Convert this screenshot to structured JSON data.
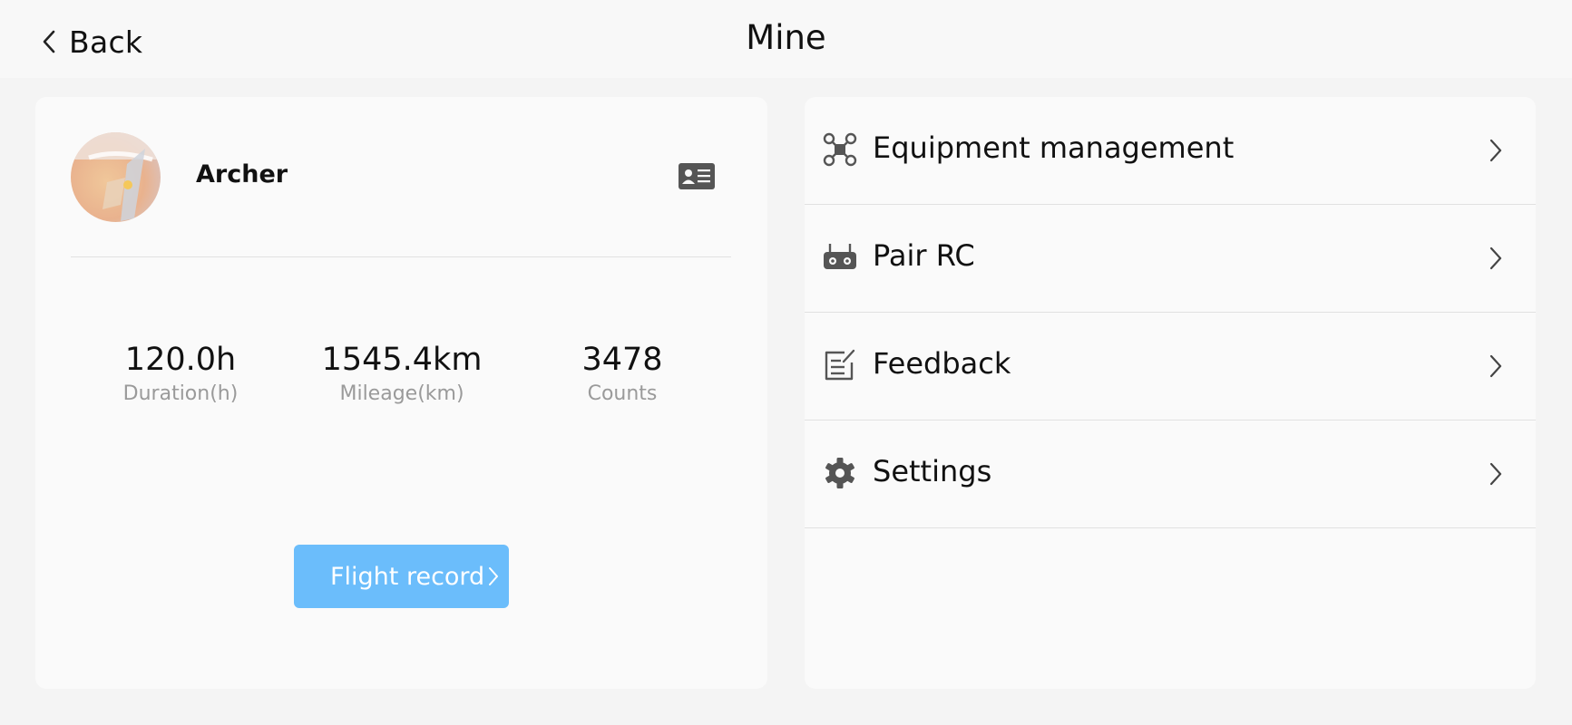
{
  "header": {
    "back_label": "Back",
    "title": "Mine"
  },
  "profile": {
    "username": "Archer",
    "stats": [
      {
        "value": "120.0h",
        "label": "Duration(h)"
      },
      {
        "value": "1545.4km",
        "label": "Mileage(km)"
      },
      {
        "value": "3478",
        "label": "Counts"
      }
    ],
    "flight_record_label": "Flight record"
  },
  "menu": [
    {
      "label": "Equipment management",
      "icon": "drone-icon"
    },
    {
      "label": "Pair RC",
      "icon": "remote-controller-icon"
    },
    {
      "label": "Feedback",
      "icon": "feedback-icon"
    },
    {
      "label": "Settings",
      "icon": "gear-icon"
    }
  ],
  "colors": {
    "accent_button": "#6bbdfb",
    "background": "#f4f4f4",
    "card": "#fafafa",
    "secondary_text": "#9a9a9a",
    "icon": "#555555"
  }
}
